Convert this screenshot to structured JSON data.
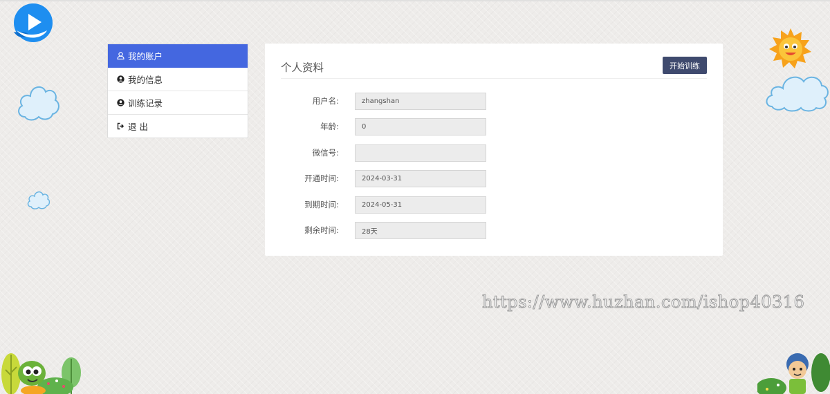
{
  "sidebar": {
    "items": [
      {
        "label": "我的账户",
        "icon": "user-outline-icon",
        "active": true
      },
      {
        "label": "我的信息",
        "icon": "user-circle-icon",
        "active": false
      },
      {
        "label": "训练记录",
        "icon": "user-circle-icon",
        "active": false
      },
      {
        "label": "退 出",
        "icon": "sign-out-icon",
        "active": false
      }
    ]
  },
  "panel": {
    "title": "个人资料",
    "start_button": "开始训练",
    "fields": [
      {
        "label": "用户名:",
        "value": "zhangshan"
      },
      {
        "label": "年龄:",
        "value": "0"
      },
      {
        "label": "微信号:",
        "value": ""
      },
      {
        "label": "开通时间:",
        "value": "2024-03-31"
      },
      {
        "label": "到期时间:",
        "value": "2024-05-31"
      },
      {
        "label": "剩余时间:",
        "value": "28天"
      }
    ]
  },
  "watermark": "https://www.huzhan.com/ishop40316",
  "colors": {
    "accent": "#4467e0",
    "button": "#3f4a6e",
    "logo": "#1f8ff0"
  }
}
